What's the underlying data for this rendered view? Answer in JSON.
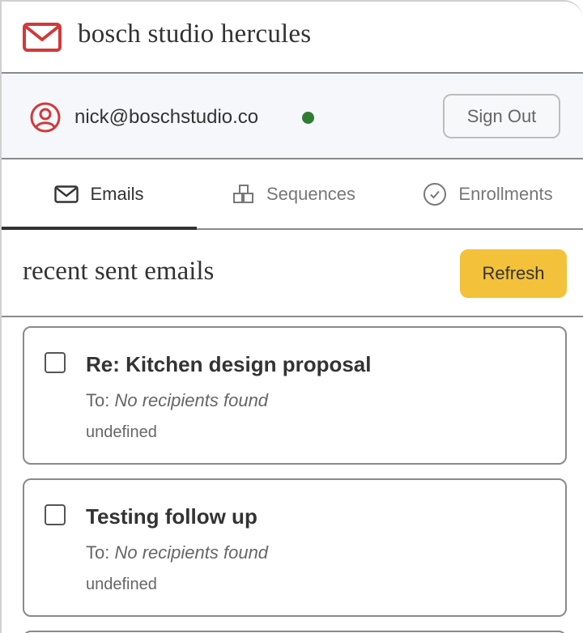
{
  "app": {
    "title": "bosch studio hercules",
    "logo_icon": "mail-icon",
    "brand_color": "#d03a3a"
  },
  "user": {
    "email": "nick@boschstudio.co",
    "avatar_icon": "user-circle-icon",
    "status_color": "#2e7d32",
    "sign_out_label": "Sign Out"
  },
  "tabs": [
    {
      "label": "Emails",
      "icon": "mail-icon",
      "active": true
    },
    {
      "label": "Sequences",
      "icon": "sequences-icon",
      "active": false
    },
    {
      "label": "Enrollments",
      "icon": "check-circle-icon",
      "active": false
    }
  ],
  "section": {
    "title": "recent sent emails",
    "refresh_label": "Refresh",
    "refresh_color": "#f3c13a"
  },
  "emails": [
    {
      "subject": "Re: Kitchen design proposal",
      "to_label": "To:",
      "to_value": "No recipients found",
      "meta": "undefined",
      "checked": false
    },
    {
      "subject": "Testing follow up",
      "to_label": "To:",
      "to_value": "No recipients found",
      "meta": "undefined",
      "checked": false
    }
  ]
}
